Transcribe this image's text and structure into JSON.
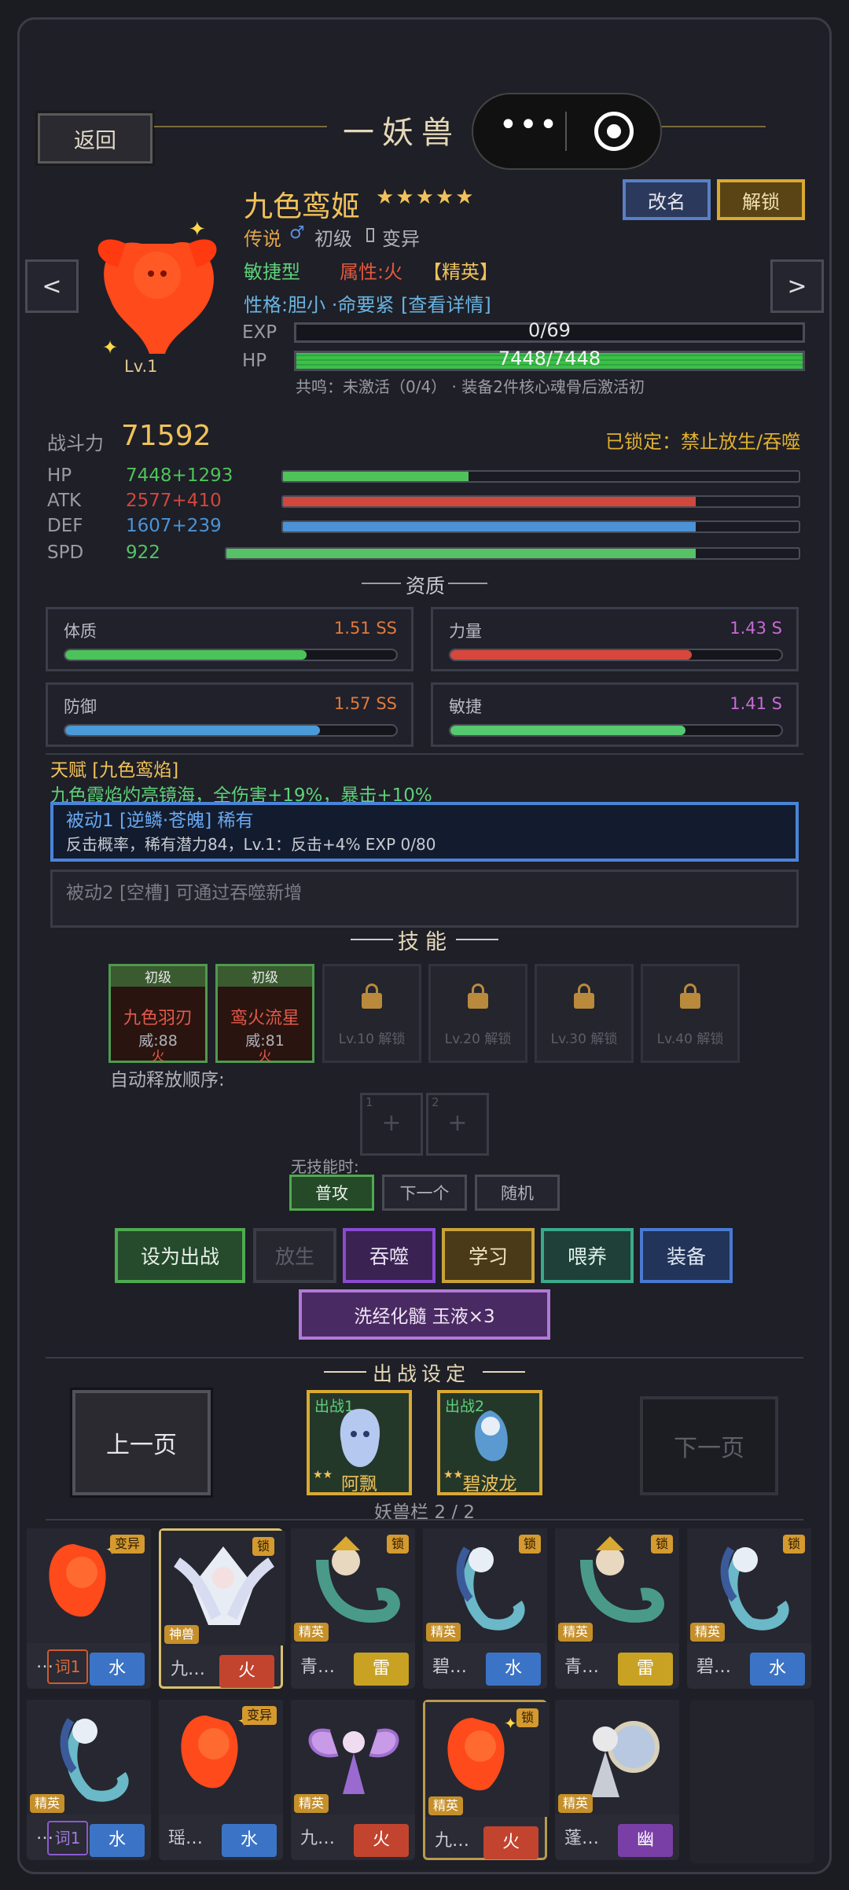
{
  "header": {
    "back_label": "返回",
    "title": "一妖兽"
  },
  "pet": {
    "name": "九色鸾姬",
    "stars": "★★★★★",
    "level": "Lv.1",
    "rarity": "传说",
    "rank": "初级",
    "variant": "变异",
    "type": "敏捷型",
    "element_label": "属性:火",
    "quality": "【精英】",
    "personality": "性格:胆小 ·命要紧",
    "detail_link": "[查看详情]",
    "exp_label": "EXP",
    "exp_text": "0/69",
    "exp_fraction": 0,
    "hp_label": "HP",
    "hp_text": "7448/7448",
    "hp_fraction": 1.0,
    "resonance": "共鸣：未激活（0/4） · 装备2件核心魂骨后激活初",
    "rename_label": "改名",
    "unlock_label": "解锁",
    "prev": "<",
    "next": ">"
  },
  "combat": {
    "label": "战斗力",
    "value": "71592",
    "locked": "已锁定：禁止放生/吞噬"
  },
  "stats": [
    {
      "name": "HP",
      "value": "7448+1293",
      "color": "#4fc25a",
      "fraction": 0.36
    },
    {
      "name": "ATK",
      "value": "2577+410",
      "color": "#d0473c",
      "fraction": 0.8
    },
    {
      "name": "DEF",
      "value": "1607+239",
      "color": "#4b93d6",
      "fraction": 0.8
    },
    {
      "name": "SPD",
      "value": "922",
      "color": "#55c266",
      "fraction": 0.8
    }
  ],
  "aptitude": {
    "title": "资质",
    "items": [
      {
        "name": "体质",
        "value": "1.51 SS",
        "color": "#e07a3e",
        "bar": "#4cc35a",
        "fraction": 0.73
      },
      {
        "name": "力量",
        "value": "1.43 S",
        "color": "#c76ad6",
        "bar": "#d7473c",
        "fraction": 0.73
      },
      {
        "name": "防御",
        "value": "1.57 SS",
        "color": "#e07a3e",
        "bar": "#4b9ad8",
        "fraction": 0.77
      },
      {
        "name": "敏捷",
        "value": "1.41 S",
        "color": "#c76ad6",
        "bar": "#55c96e",
        "fraction": 0.71
      }
    ]
  },
  "talent": {
    "title": "天赋 [九色鸾焰]",
    "desc": "九色霞焰灼亮镜海，全伤害+19%，暴击+10%"
  },
  "passive1": {
    "title": "被动1 [逆鳞·苍魄] 稀有",
    "desc": "反击概率，稀有潜力84，Lv.1：反击+4%  EXP 0/80"
  },
  "passive2": {
    "text": "被动2 [空槽] 可通过吞噬新增"
  },
  "skills": {
    "title": "技能",
    "learned": [
      {
        "tier": "初级",
        "name": "九色羽刃",
        "power": "威:88",
        "elem": "火"
      },
      {
        "tier": "初级",
        "name": "鸾火流星",
        "power": "威:81",
        "elem": "火"
      }
    ],
    "locked": [
      "Lv.10 解锁",
      "Lv.20 解锁",
      "Lv.30 解锁",
      "Lv.40 解锁"
    ],
    "order_label": "自动释放顺序:",
    "order_slots": [
      {
        "num": "1",
        "plus": "+"
      },
      {
        "num": "2",
        "plus": "+"
      }
    ],
    "no_skill_label": "无技能时:",
    "modes": [
      "普攻",
      "下一个",
      "随机"
    ]
  },
  "actions": {
    "deploy": "设为出战",
    "release": "放生",
    "devour": "吞噬",
    "learn": "学习",
    "feed": "喂养",
    "equip": "装备",
    "refine": "洗经化髓 玉液×3"
  },
  "battle": {
    "title": "出战设定",
    "prev": "上一页",
    "next": "下一页",
    "slots": [
      {
        "label": "出战1",
        "name": "阿飘",
        "stars": "★★"
      },
      {
        "label": "出战2",
        "name": "碧波龙",
        "stars": "★★"
      }
    ],
    "capacity": "妖兽栏 2 / 2"
  },
  "roster": [
    {
      "tag": "变异",
      "rank": "",
      "name": "…",
      "ci": "词1",
      "el": "水",
      "elc": "#3b74c6",
      "art": "fire"
    },
    {
      "tag": "锁",
      "rank": "神兽",
      "name": "九…",
      "ci": "",
      "el": "火",
      "elc": "#c2442e",
      "art": "fox"
    },
    {
      "tag": "锁",
      "rank": "精英",
      "name": "青…",
      "ci": "",
      "el": "雷",
      "elc": "#c9a224",
      "art": "dragon"
    },
    {
      "tag": "锁",
      "rank": "精英",
      "name": "碧…",
      "ci": "",
      "el": "水",
      "elc": "#3b74c6",
      "art": "mermaid"
    },
    {
      "tag": "锁",
      "rank": "精英",
      "name": "青…",
      "ci": "",
      "el": "雷",
      "elc": "#c9a224",
      "art": "dragon"
    },
    {
      "tag": "锁",
      "rank": "精英",
      "name": "碧…",
      "ci": "",
      "el": "水",
      "elc": "#3b74c6",
      "art": "mermaid"
    },
    {
      "tag": "",
      "rank": "精英",
      "name": "…",
      "ci": "词1",
      "el": "水",
      "elc": "#3b74c6",
      "art": "mermaid"
    },
    {
      "tag": "变异",
      "rank": "",
      "name": "瑶…",
      "ci": "",
      "el": "水",
      "elc": "#3b74c6",
      "art": "fire"
    },
    {
      "tag": "",
      "rank": "精英",
      "name": "九…",
      "ci": "",
      "el": "火",
      "elc": "#c2442e",
      "art": "fairy"
    },
    {
      "tag": "锁",
      "rank": "精英",
      "name": "九…",
      "ci": "",
      "el": "火",
      "elc": "#c2442e",
      "art": "fire"
    },
    {
      "tag": "",
      "rank": "精英",
      "name": "蓬…",
      "ci": "",
      "el": "幽",
      "elc": "#7a3fa6",
      "art": "mirror"
    }
  ],
  "capsule": {
    "more": "•••"
  }
}
